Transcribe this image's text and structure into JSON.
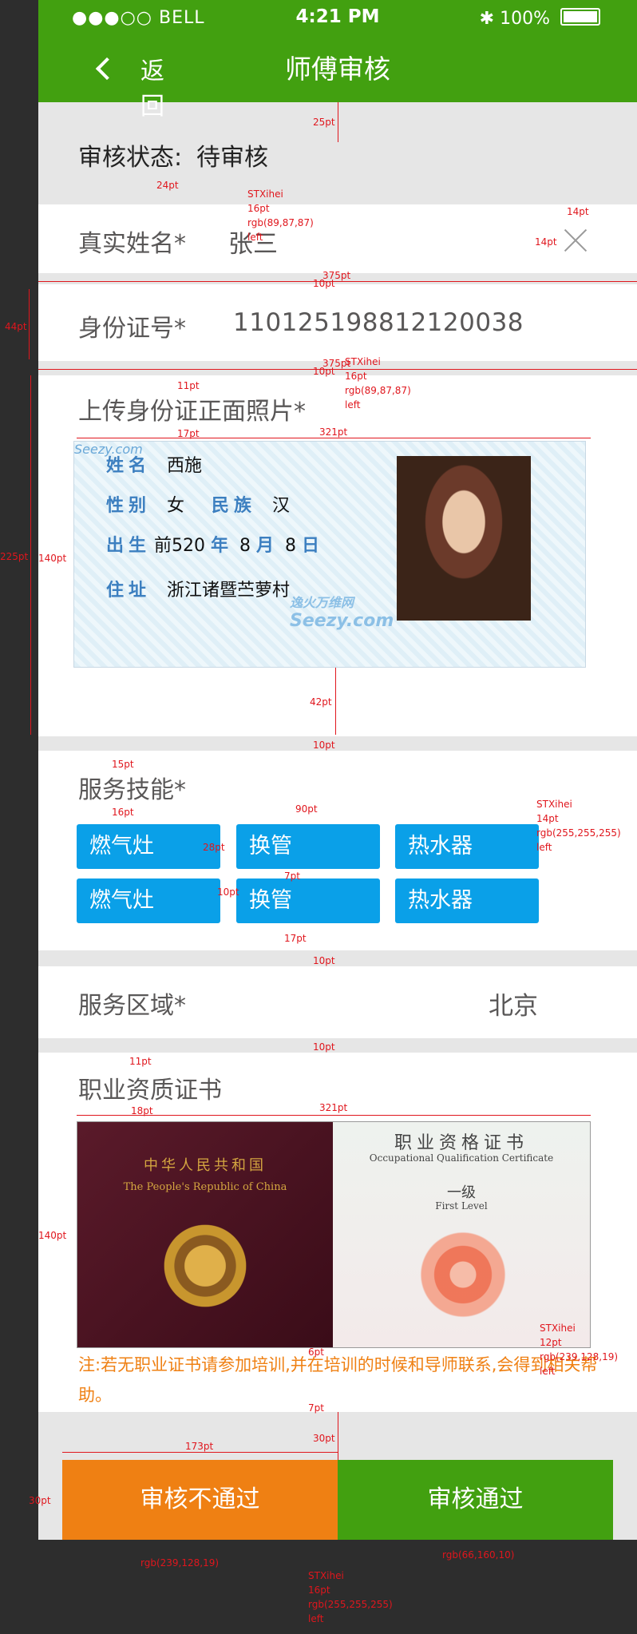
{
  "status_bar": {
    "carrier": "●●●○○ BELL",
    "time": "4:21 PM",
    "battery": "100%"
  },
  "nav": {
    "back_label": "返回",
    "title": "师傅审核"
  },
  "review_status": {
    "label": "审核状态:",
    "value": "待审核"
  },
  "name": {
    "label": "真实姓名*",
    "value": "张三"
  },
  "id_number": {
    "label": "身份证号*",
    "value": "110125198812120038"
  },
  "id_photo": {
    "label": "上传身份证正面照片*",
    "card": {
      "name_key": "姓名",
      "name": "西施",
      "gender_key": "性别",
      "gender": "女",
      "ethnic_key": "民族",
      "ethnic": "汉",
      "birth_key": "出生",
      "birth_prefix": "前520",
      "year_key": "年",
      "month_num": "8",
      "month_key": "月",
      "day_num": "8",
      "day_key": "日",
      "address_key": "住址",
      "address": "浙江诸暨苎萝村",
      "watermark_top": "Seezy.com",
      "watermark_mid_cn": "逸火万维网",
      "watermark_mid": "Seezy.com"
    }
  },
  "skills": {
    "label": "服务技能*",
    "items": [
      "燃气灶",
      "换管",
      "热水器",
      "燃气灶",
      "换管",
      "热水器"
    ]
  },
  "area": {
    "label": "服务区域*",
    "value": "北京"
  },
  "certificate": {
    "label": "职业资质证书",
    "left_cn": "中华人民共和国",
    "left_en": "The People's Republic of China",
    "right_cn": "职业资格证书",
    "right_en": "Occupational Qualification Certificate",
    "level_cn": "一级",
    "level_en": "First Level"
  },
  "note": "注:若无职业证书请参加培训,并在培训的时候和导师联系,会得到相关帮助。",
  "buttons": {
    "reject": "审核不通过",
    "approve": "审核通过"
  },
  "colors": {
    "green": "#42a010",
    "orange": "#ef8013",
    "blue": "#0aa0e8",
    "text": "#595757",
    "annotation": "#e0161d"
  },
  "annotations": {
    "a25": "25pt",
    "a24": "24pt",
    "font1": "STXihei",
    "size1": "16pt",
    "color1": "rgb(89,87,87)",
    "align1": "left",
    "a14w": "14pt",
    "a14h": "14pt",
    "a375a": "375pt",
    "a10a": "10pt",
    "a44": "44pt",
    "a375b": "375pt",
    "a10b": "10pt",
    "font2": "STXihei",
    "size2": "16pt",
    "color2": "rgb(89,87,87)",
    "align2": "left",
    "a11": "11pt",
    "a17": "17pt",
    "a321a": "321pt",
    "a225": "225pt",
    "a140a": "140pt",
    "a42": "42pt",
    "a10c": "10pt",
    "a15": "15pt",
    "a16": "16pt",
    "a90": "90pt",
    "a28": "28pt",
    "a7a": "7pt",
    "a10d": "10pt",
    "a17b": "17pt",
    "a10e": "10pt",
    "font3": "STXihei",
    "size3": "14pt",
    "color3": "rgb(255,255,255)",
    "align3": "left",
    "a10f": "10pt",
    "a11b": "11pt",
    "a18": "18pt",
    "a321b": "321pt",
    "a140b": "140pt",
    "a6": "6pt",
    "font4": "STXihei",
    "size4": "12pt",
    "color4": "rgb(239,128,19)",
    "align4": "left",
    "a7b": "7pt",
    "a30": "30pt",
    "a173": "173pt",
    "a30b": "30pt",
    "color5": "rgb(239,128,19)",
    "color6": "rgb(66,160,10)",
    "font7": "STXihei",
    "size7": "16pt",
    "color7": "rgb(255,255,255)",
    "align7": "left"
  }
}
